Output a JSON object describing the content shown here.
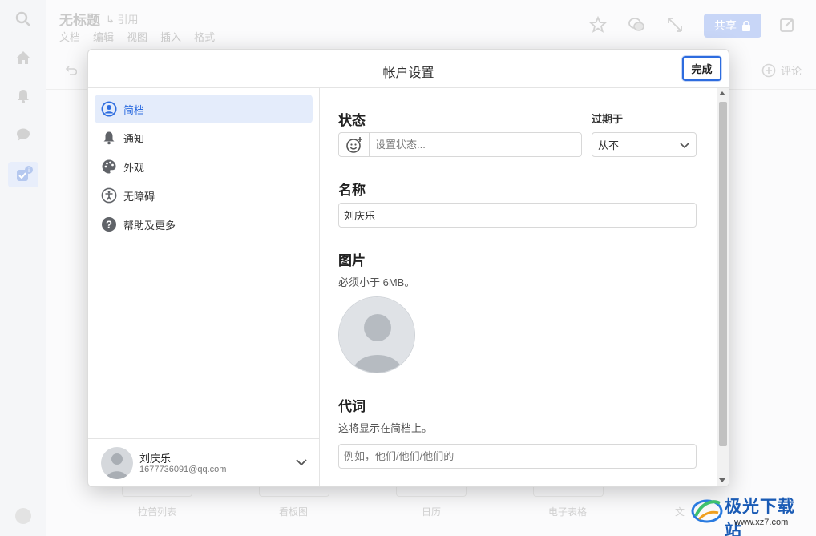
{
  "background": {
    "doc_title": "无标题",
    "ref_label": "↳ 引用",
    "menu": [
      "文档",
      "编辑",
      "视图",
      "插入",
      "格式"
    ],
    "share_label": "共享",
    "comment_label": "评论",
    "bottom_labels": [
      "拉普列表",
      "看板图",
      "日历",
      "电子表格",
      "文"
    ]
  },
  "dialog": {
    "title": "帐户设置",
    "done_label": "完成"
  },
  "sidebar": {
    "items": [
      {
        "label": "简档",
        "icon": "profile-icon"
      },
      {
        "label": "通知",
        "icon": "bell-icon"
      },
      {
        "label": "外观",
        "icon": "palette-icon"
      },
      {
        "label": "无障碍",
        "icon": "accessibility-icon"
      },
      {
        "label": "帮助及更多",
        "icon": "help-icon"
      }
    ],
    "user": {
      "name": "刘庆乐",
      "email": "1677736091@qq.com"
    }
  },
  "content": {
    "status_heading": "状态",
    "status_placeholder": "设置状态...",
    "expire_label": "过期于",
    "expire_value": "从不",
    "name_heading": "名称",
    "name_value": "刘庆乐",
    "picture_heading": "图片",
    "picture_hint": "必须小于 6MB。",
    "pronoun_heading": "代词",
    "pronoun_hint": "这将显示在简档上。",
    "pronoun_placeholder": "例如，他们/他们/他们的"
  },
  "watermark": {
    "brand": "极光下载站",
    "url": "www.xz7.com"
  },
  "colors": {
    "accent": "#2d6cdf",
    "active_bg": "#e4ecfb"
  }
}
